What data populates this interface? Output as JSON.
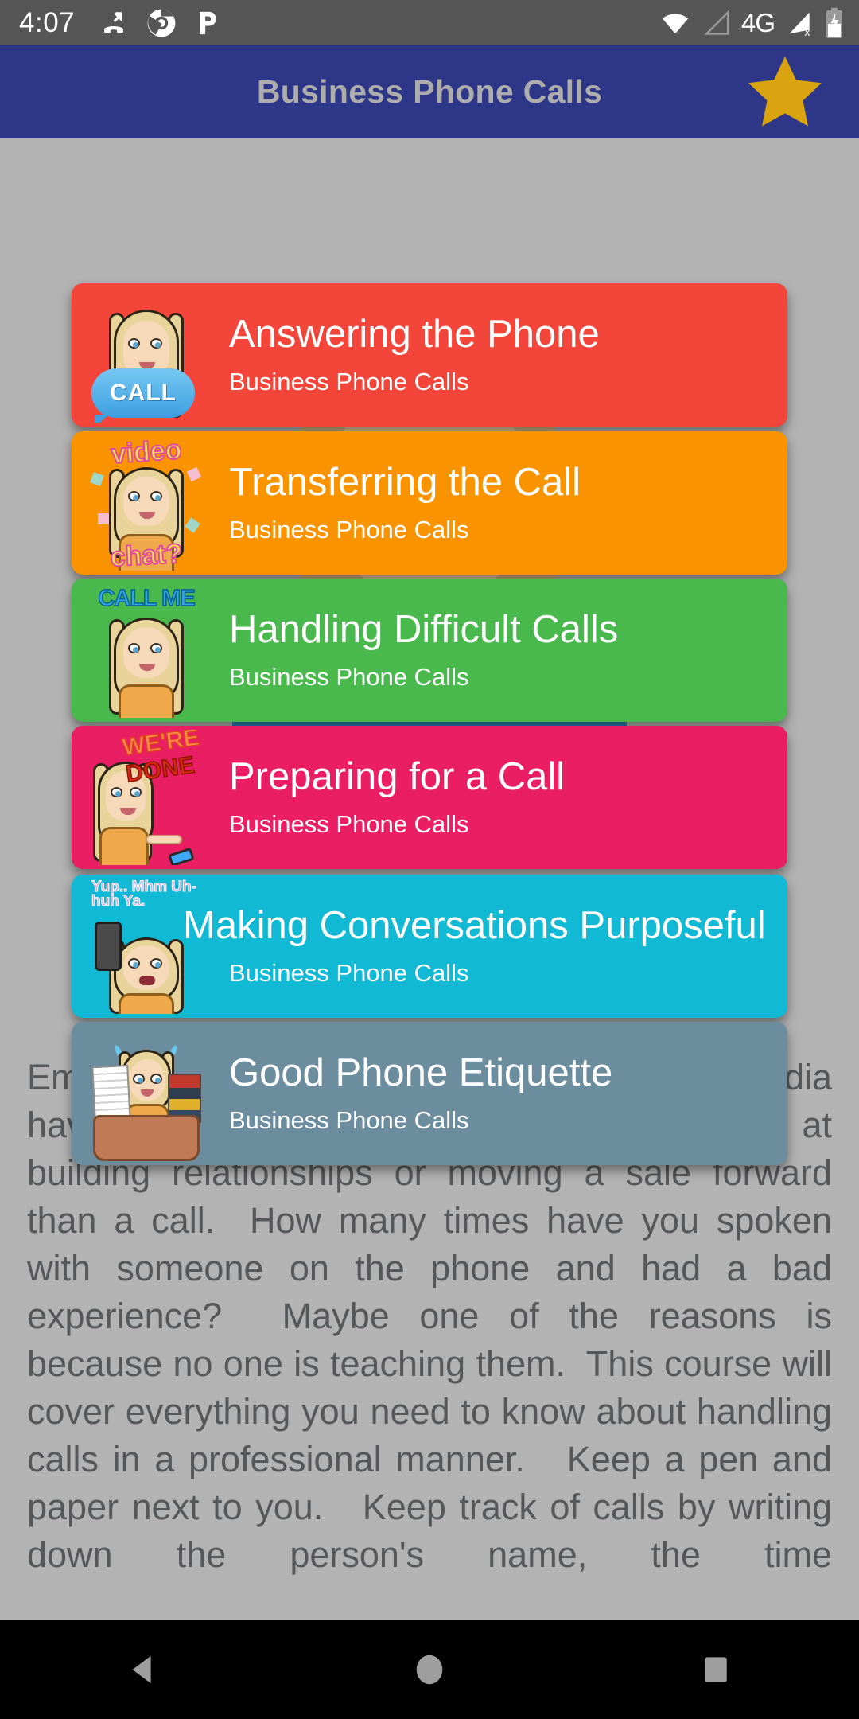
{
  "status_bar": {
    "time": "4:07",
    "left_icons": [
      "missed-call-icon",
      "chrome-icon",
      "pandora-icon"
    ],
    "right_icons": [
      "wifi-icon",
      "signal-empty-icon",
      "mobile-network-label",
      "signal-off-icon",
      "battery-charging-icon"
    ],
    "network_label": "4G",
    "background_color": "#565656"
  },
  "app_bar": {
    "title": "Business Phone Calls",
    "title_color": "#adadad",
    "background_color": "#2e3688",
    "favorite_icon": "star-icon",
    "favorite_icon_color": "#d9a40f"
  },
  "background_article": {
    "text": "Emails, live chat, web inquirers, and social media have their place, but nothing is still better at building relationships or moving a sale forward than a call.  How many times have you spoken with someone on the phone and had a bad experience?  Maybe one of the reasons is because no one is teaching them.  This course will cover everything you need to know about handling calls in a professional manner.   Keep a pen and paper next to you.   Keep track of calls by writing down the person's name, the time",
    "text_color": "#555759",
    "background_color": "#b3b3b3",
    "illustration": "bitmoji-phone-call-illustration"
  },
  "lesson_cards": [
    {
      "title": "Answering the Phone",
      "subtitle": "Business Phone Calls",
      "color": "#f4453a",
      "thumb": "bitmoji-call-bubble",
      "clipped": false
    },
    {
      "title": "Transferring the Call",
      "subtitle": "Business Phone Calls",
      "color": "#f99400",
      "thumb": "bitmoji-video-chat",
      "clipped": false
    },
    {
      "title": "Handling Difficult Calls",
      "subtitle": "Business Phone Calls",
      "color": "#49b84d",
      "thumb": "bitmoji-call-me",
      "clipped": false
    },
    {
      "title": "Preparing for a Call",
      "subtitle": "Business Phone Calls",
      "color": "#e91e63",
      "thumb": "bitmoji-were-done",
      "clipped": false
    },
    {
      "title": "Making Conversations Purposeful",
      "subtitle": "Business Phone Calls",
      "color": "#12b9d4",
      "thumb": "bitmoji-yup-uhhuh",
      "clipped": true
    },
    {
      "title": "Good Phone Etiquette",
      "subtitle": "Business Phone Calls",
      "color": "#6b8d9e",
      "thumb": "bitmoji-busy-desk",
      "clipped": false
    }
  ],
  "navigation_bar": {
    "background_color": "#000000",
    "buttons": [
      {
        "name": "back-button",
        "icon": "triangle-left-icon"
      },
      {
        "name": "home-button",
        "icon": "circle-icon"
      },
      {
        "name": "recents-button",
        "icon": "square-icon"
      }
    ]
  },
  "thumb_art": {
    "call_label": "CALL",
    "video_label": "video",
    "chat_label": "chat?",
    "callme_label": "CALL ME",
    "were_label": "WE'RE",
    "done_label": "DONE",
    "yup_label": "Yup.. Mhm Uh-huh Ya."
  }
}
